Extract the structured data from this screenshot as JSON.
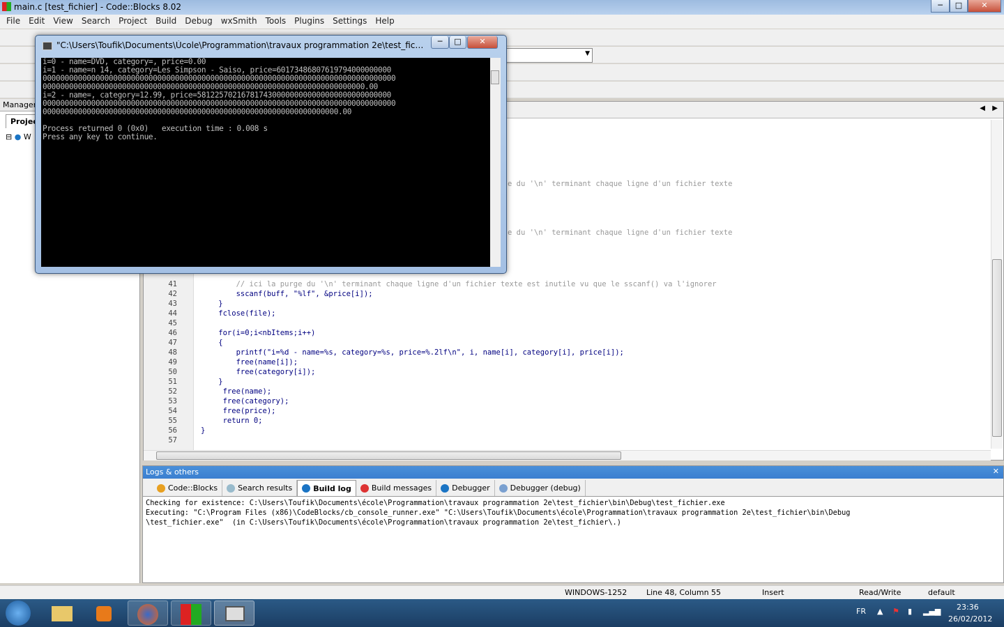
{
  "window": {
    "title": "main.c [test_fichier] - Code::Blocks 8.02",
    "minimize": "─",
    "maximize": "□",
    "close": "✕"
  },
  "menu": [
    "File",
    "Edit",
    "View",
    "Search",
    "Project",
    "Build",
    "Debug",
    "wxSmith",
    "Tools",
    "Plugins",
    "Settings",
    "Help"
  ],
  "left_panel": {
    "header": "Managem",
    "tab": "Projec",
    "tree_item": "W"
  },
  "editor": {
    "partial_lines": [
      "e du '\\n' terminant chaque ligne d'un fichier texte",
      "e du '\\n' terminant chaque ligne d'un fichier texte"
    ],
    "lines": [
      {
        "n": "41",
        "code": "        // ici la purge du '\\n' terminant chaque ligne d'un fichier texte est inutile vu que le sscanf() va l'ignorer",
        "comment": true
      },
      {
        "n": "42",
        "code": "        sscanf(buff, \"%lf\", &price[i]);"
      },
      {
        "n": "43",
        "code": "    }"
      },
      {
        "n": "44",
        "code": "    fclose(file);"
      },
      {
        "n": "45",
        "code": ""
      },
      {
        "n": "46",
        "code": "    for(i=0;i<nbItems;i++)"
      },
      {
        "n": "47",
        "code": "    {"
      },
      {
        "n": "48",
        "code": "        printf(\"i=%d - name=%s, category=%s, price=%.2lf\\n\", i, name[i], category[i], price[i]);"
      },
      {
        "n": "49",
        "code": "        free(name[i]);"
      },
      {
        "n": "50",
        "code": "        free(category[i]);"
      },
      {
        "n": "51",
        "code": "    }"
      },
      {
        "n": "52",
        "code": "     free(name);"
      },
      {
        "n": "53",
        "code": "     free(category);"
      },
      {
        "n": "54",
        "code": "     free(price);"
      },
      {
        "n": "55",
        "code": "     return 0;"
      },
      {
        "n": "56",
        "code": "}"
      },
      {
        "n": "57",
        "code": ""
      }
    ]
  },
  "logs": {
    "title": "Logs & others",
    "close": "✕",
    "tabs": [
      {
        "label": "Code::Blocks",
        "icon": "pencil-icon"
      },
      {
        "label": "Search results",
        "icon": "magnifier-icon"
      },
      {
        "label": "Build log",
        "icon": "gear-icon",
        "active": true
      },
      {
        "label": "Build messages",
        "icon": "pin-icon"
      },
      {
        "label": "Debugger",
        "icon": "gear-icon"
      },
      {
        "label": "Debugger (debug)",
        "icon": "book-icon"
      }
    ],
    "lines": [
      "Checking for existence: C:\\Users\\Toufik\\Documents\\école\\Programmation\\travaux programmation 2e\\test_fichier\\bin\\Debug\\test_fichier.exe",
      "Executing: \"C:\\Program Files (x86)\\CodeBlocks/cb_console_runner.exe\" \"C:\\Users\\Toufik\\Documents\\école\\Programmation\\travaux programmation 2e\\test_fichier\\bin\\Debug",
      "\\test_fichier.exe\"  (in C:\\Users\\Toufik\\Documents\\école\\Programmation\\travaux programmation 2e\\test_fichier\\.)"
    ]
  },
  "status": {
    "encoding": "WINDOWS-1252",
    "position": "Line 48, Column 55",
    "mode": "Insert",
    "access": "Read/Write",
    "profile": "default"
  },
  "console": {
    "title": "\"C:\\Users\\Toufik\\Documents\\Úcole\\Programmation\\travaux programmation 2e\\test_fichier\\bin\\De...",
    "lines": [
      "i=0 - name=DVD, category=, price=0.00",
      "i=1 - name=n 14, category=Les Simpson - Saiso, price=60173486807619794000000000",
      "00000000000000000000000000000000000000000000000000000000000000000000000000000000",
      "0000000000000000000000000000000000000000000000000000000000000000000000000.00",
      "i=2 - name=, category=12.99, price=58122570216781743000000000000000000000000000",
      "00000000000000000000000000000000000000000000000000000000000000000000000000000000",
      "0000000000000000000000000000000000000000000000000000000000000000000.00",
      "",
      "Process returned 0 (0x0)   execution time : 0.008 s",
      "Press any key to continue."
    ]
  },
  "taskbar": {
    "lang": "FR",
    "time": "23:36",
    "date": "26/02/2012"
  }
}
